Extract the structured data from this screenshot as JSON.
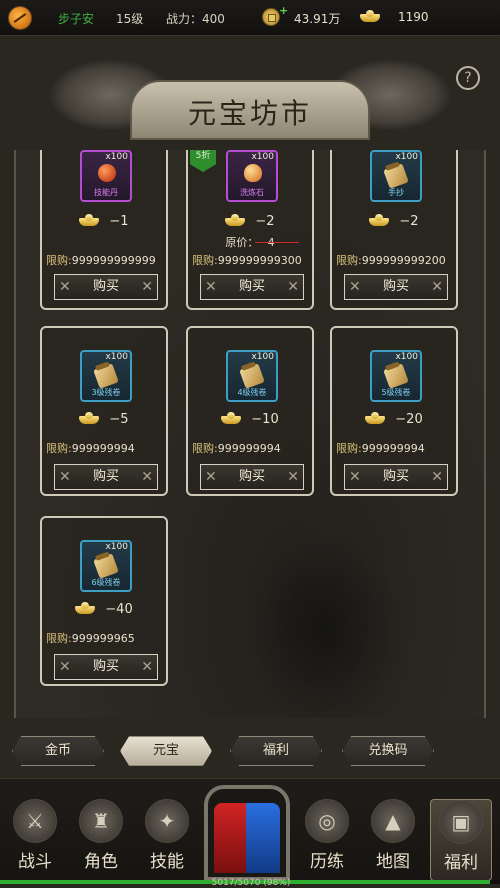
{
  "topbar": {
    "player_name": "步子安",
    "level": "15级",
    "power_label": "战力：400",
    "gold": "43.91万",
    "ingots": "1190"
  },
  "title": "元宝坊市",
  "help": "?",
  "shop": {
    "buy_label": "购买",
    "limit_label": "限购:",
    "items": [
      {
        "name": "技能丹",
        "qty": "x100",
        "price": "−1",
        "limit": "999999999999",
        "frame": "purple",
        "icon": "orb-icon"
      },
      {
        "name": "洗炼石",
        "qty": "x100",
        "price": "−2",
        "orig_label": "原价：",
        "orig_price": "−4",
        "discount": "5折",
        "limit": "999999999300",
        "frame": "purple",
        "icon": "stone-icon"
      },
      {
        "name": "手抄",
        "qty": "x100",
        "price": "−2",
        "limit": "999999999200",
        "frame": "blue",
        "icon": "scroll-icon"
      },
      {
        "name": "3级残卷",
        "qty": "x100",
        "price": "−5",
        "limit": "999999994",
        "frame": "blue",
        "icon": "scroll-icon"
      },
      {
        "name": "4级残卷",
        "qty": "x100",
        "price": "−10",
        "limit": "999999994",
        "frame": "blue",
        "icon": "scroll-icon"
      },
      {
        "name": "5级残卷",
        "qty": "x100",
        "price": "−20",
        "limit": "999999994",
        "frame": "blue",
        "icon": "scroll-icon"
      },
      {
        "name": "6级残卷",
        "qty": "x100",
        "price": "−40",
        "limit": "999999965",
        "frame": "blue",
        "icon": "scroll-icon"
      }
    ]
  },
  "tabs": [
    {
      "label": "金币",
      "active": false
    },
    {
      "label": "元宝",
      "active": true
    },
    {
      "label": "福利",
      "active": false
    },
    {
      "label": "兑换码",
      "active": false
    }
  ],
  "nav": [
    {
      "label": "战斗",
      "icon": "crossed-swords-icon"
    },
    {
      "label": "角色",
      "icon": "helmet-icon"
    },
    {
      "label": "技能",
      "icon": "flame-icon"
    },
    {
      "label": "历练",
      "icon": "vortex-icon"
    },
    {
      "label": "地图",
      "icon": "mountain-icon"
    },
    {
      "label": "福利",
      "icon": "treasure-chest-icon",
      "active": true
    }
  ],
  "exp": {
    "text": "5017/5070 (98%)",
    "progress": 0.98
  },
  "colors": {
    "accent_green": "#2fae2f",
    "frame_purple": "#b44dd1",
    "frame_blue": "#3d9fc4"
  }
}
